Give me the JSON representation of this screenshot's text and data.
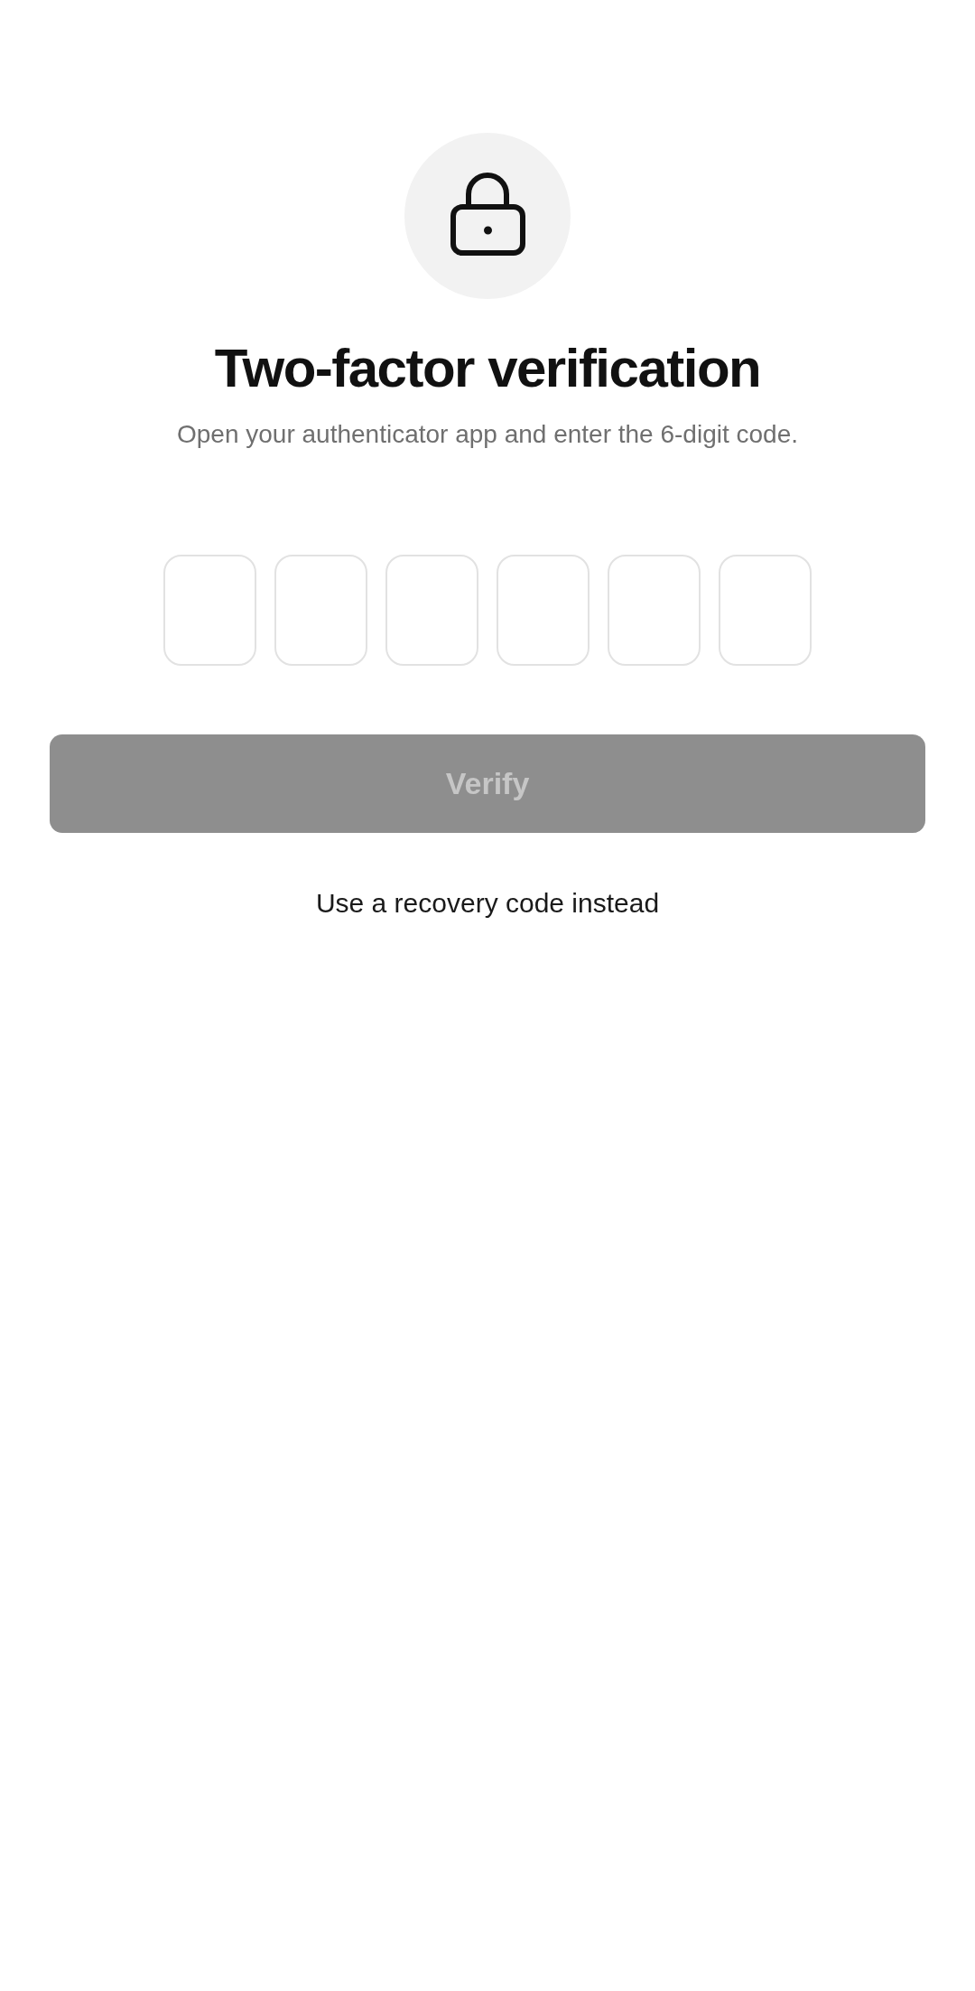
{
  "header": {
    "title": "Two-factor verification",
    "subtitle": "Open your authenticator app and enter the 6-digit code."
  },
  "code_boxes": [
    {
      "focused": false
    },
    {
      "focused": false
    },
    {
      "focused": false
    },
    {
      "focused": false
    },
    {
      "focused": false
    },
    {
      "focused": false
    }
  ],
  "verify_button": {
    "label": "Verify",
    "disabled": true
  },
  "recovery_link": {
    "label": "Use a recovery code instead"
  }
}
